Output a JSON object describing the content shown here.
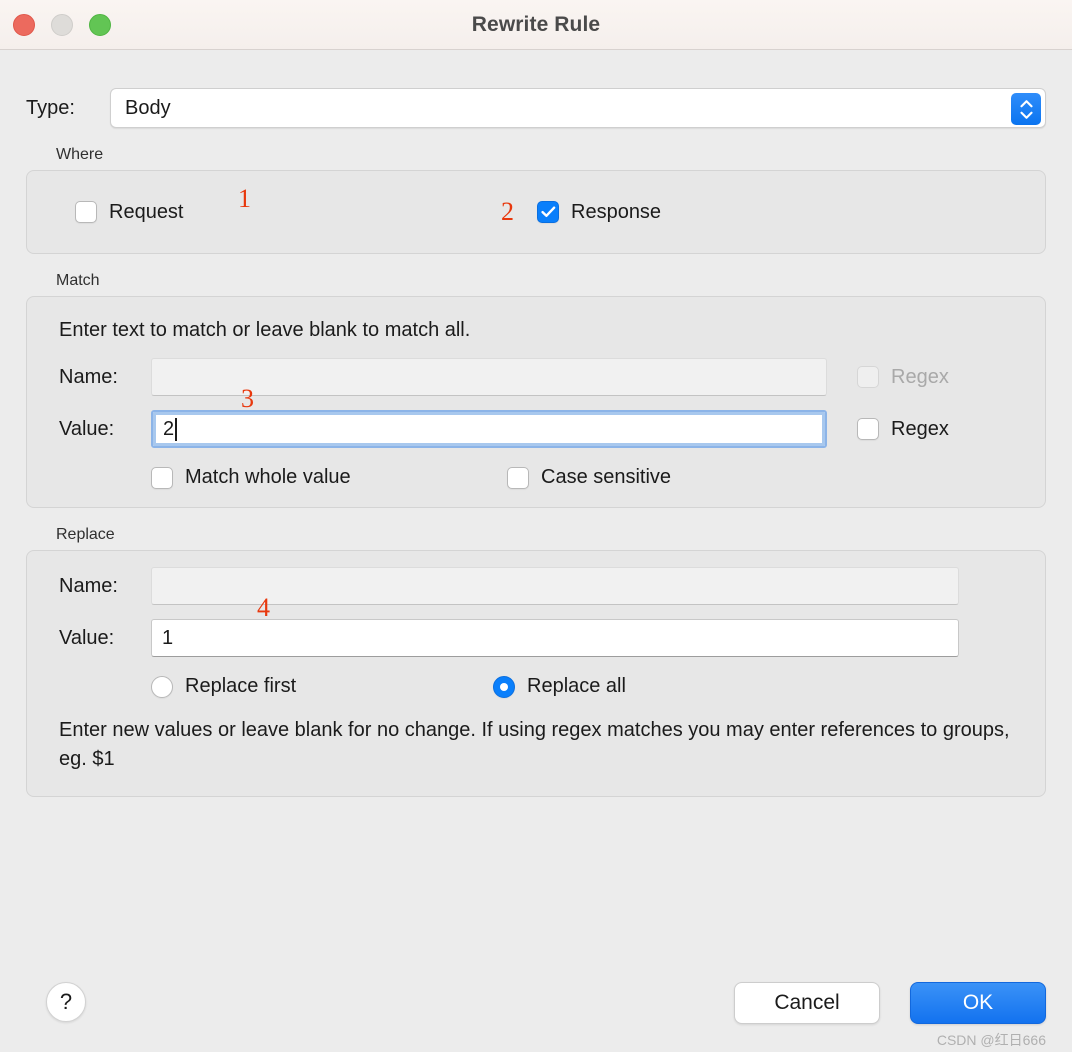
{
  "window": {
    "title": "Rewrite Rule",
    "traffic_lights": [
      {
        "name": "close",
        "color": "#ec6a5e"
      },
      {
        "name": "minimize",
        "color": "#dedcd9"
      },
      {
        "name": "zoom",
        "color": "#62c554"
      }
    ]
  },
  "type_row": {
    "label": "Type:",
    "selected": "Body",
    "annotation": "1"
  },
  "where": {
    "group_label": "Where",
    "request": {
      "label": "Request",
      "checked": false
    },
    "response": {
      "label": "Response",
      "checked": true,
      "annotation": "2"
    }
  },
  "match": {
    "group_label": "Match",
    "hint": "Enter text to match or leave blank to match all.",
    "name": {
      "label": "Name:",
      "value": "",
      "placeholder": "",
      "disabled": true
    },
    "name_regex": {
      "label": "Regex",
      "checked": false,
      "disabled": true
    },
    "value": {
      "label": "Value:",
      "value": "2",
      "placeholder": "",
      "focused": true,
      "annotation": "3"
    },
    "value_regex": {
      "label": "Regex",
      "checked": false,
      "disabled": false
    },
    "match_whole": {
      "label": "Match whole value",
      "checked": false
    },
    "case_sensitive": {
      "label": "Case sensitive",
      "checked": false
    }
  },
  "replace": {
    "group_label": "Replace",
    "name": {
      "label": "Name:",
      "value": "",
      "placeholder": "",
      "disabled": true
    },
    "value": {
      "label": "Value:",
      "value": "1",
      "placeholder": "",
      "annotation": "4"
    },
    "replace_first": {
      "label": "Replace first",
      "selected": false
    },
    "replace_all": {
      "label": "Replace all",
      "selected": true
    },
    "note": "Enter new values or leave blank for no change. If using regex matches you may enter references to groups, eg. $1"
  },
  "footer": {
    "help": "?",
    "cancel": "Cancel",
    "ok": "OK"
  },
  "watermark": "CSDN @红日666",
  "colors": {
    "accent_blue": "#0a7ffb",
    "annotation_red": "#e8380d",
    "window_bg": "#ececec",
    "titlebar_bg": "#f7f2ef"
  }
}
